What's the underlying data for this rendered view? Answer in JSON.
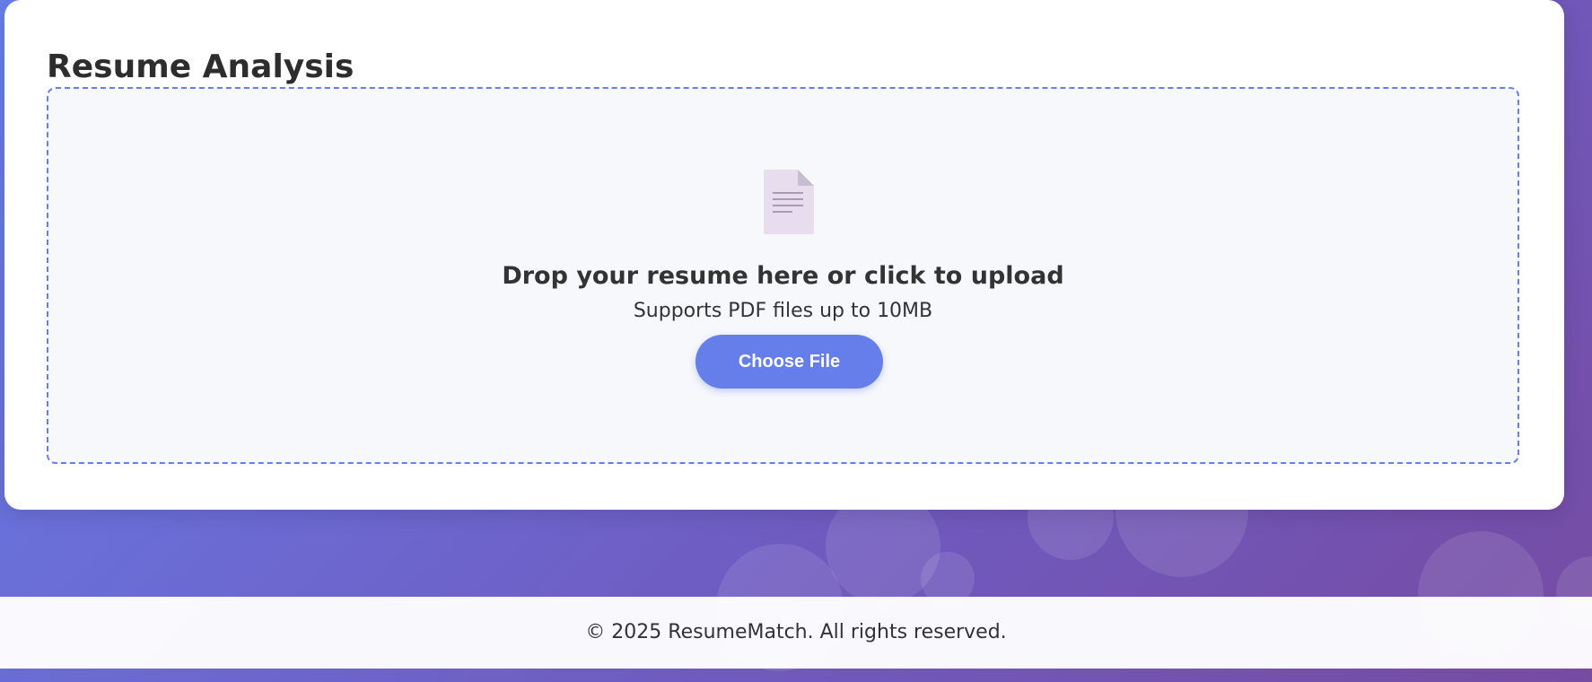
{
  "colors": {
    "accent": "#667eea",
    "background_gradient_start": "#667eea",
    "background_gradient_end": "#764ba2",
    "card": "#ffffff",
    "dropzone_bg": "#f7f8fc",
    "text": "#333333"
  },
  "main": {
    "title": "Resume Analysis"
  },
  "upload": {
    "icon": "document-icon",
    "prompt": "Drop your resume here or click to upload",
    "hint": "Supports PDF files up to 10MB",
    "button_label": "Choose File"
  },
  "footer": {
    "copyright": "© 2025 ResumeMatch. All rights reserved."
  }
}
